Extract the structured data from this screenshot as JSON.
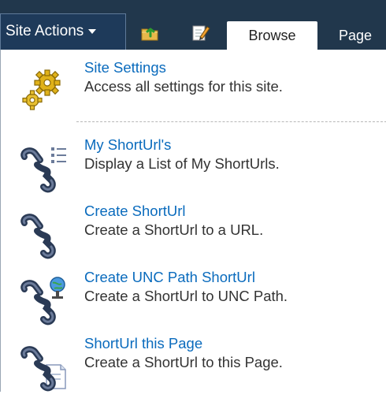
{
  "topbar": {
    "site_actions_label": "Site Actions",
    "tabs": [
      {
        "label": "Browse",
        "selected": true
      },
      {
        "label": "Page",
        "selected": false
      }
    ]
  },
  "menu": {
    "items": [
      {
        "title": "Site Settings",
        "description": "Access all settings for this site.",
        "icon": "gears-icon"
      },
      {
        "title": "My ShortUrl's",
        "description": "Display a List of My ShortUrls.",
        "icon": "chain-list-icon"
      },
      {
        "title": "Create ShortUrl",
        "description": "Create a ShortUrl to a URL.",
        "icon": "chain-link-icon"
      },
      {
        "title": "Create UNC Path ShortUrl",
        "description": "Create a ShortUrl to UNC Path.",
        "icon": "chain-globe-icon"
      },
      {
        "title": "ShortUrl this Page",
        "description": "Create a ShortUrl to this Page.",
        "icon": "chain-page-icon"
      }
    ]
  },
  "colors": {
    "topbar_bg": "#21374c",
    "link_blue": "#0a6bbd",
    "description_text": "#333333"
  }
}
